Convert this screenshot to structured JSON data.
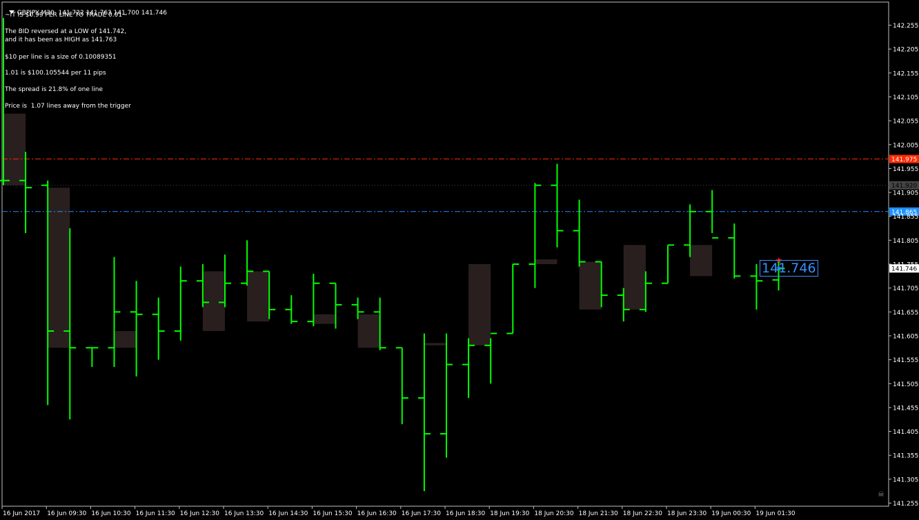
{
  "header": {
    "title": "GBPJPY,M30  141.722 141.763 141.700 141.746",
    "subtitle": "~IT IS $0.99 PER LINE TO TRADE 0.01~"
  },
  "info_lines": [
    "The BID reversed at a LOW of 141.742,",
    "and it has been as HIGH as 141.763",
    "$10 per line is a size of 0.10089351",
    "1.01 is $100.105544 per 11 pips",
    "The spread is 21.8% of one line",
    "Price is  1.07 lines away from the trigger"
  ],
  "current_price_label": "141.746",
  "colors": {
    "background": "#000000",
    "candle": "#00ff00",
    "box": "#2a1f1f",
    "red_line": "#ff2a00",
    "blue_line": "#1e90ff",
    "gray_line": "#555555",
    "axis_text": "#ffffff",
    "star_red": "#ff1a1a",
    "star_blue": "#1e90ff"
  },
  "chart_data": {
    "type": "ohlc",
    "symbol": "GBPJPY",
    "timeframe": "M30",
    "ylim": [
      141.25,
      142.28
    ],
    "y_ticks": [
      "142.255",
      "142.205",
      "142.155",
      "142.105",
      "142.055",
      "142.005",
      "141.955",
      "141.905",
      "141.855",
      "141.805",
      "141.755",
      "141.705",
      "141.655",
      "141.605",
      "141.555",
      "141.505",
      "141.455",
      "141.405",
      "141.355",
      "141.305",
      "141.255"
    ],
    "x_tick_labels": [
      "16 Jun 2017",
      "16 Jun 09:30",
      "16 Jun 10:30",
      "16 Jun 11:30",
      "16 Jun 12:30",
      "16 Jun 13:30",
      "16 Jun 14:30",
      "16 Jun 15:30",
      "16 Jun 16:30",
      "16 Jun 17:30",
      "16 Jun 18:30",
      "18 Jun 19:30",
      "18 Jun 20:30",
      "18 Jun 21:30",
      "18 Jun 22:30",
      "18 Jun 23:30",
      "19 Jun 00:30",
      "19 Jun 01:30"
    ],
    "bars": [
      {
        "o": 141.93,
        "h": 142.27,
        "l": 141.92,
        "c": 141.93
      },
      {
        "o": 141.93,
        "h": 141.99,
        "l": 141.82,
        "c": 141.915
      },
      {
        "o": 141.92,
        "h": 141.93,
        "l": 141.46,
        "c": 141.615
      },
      {
        "o": 141.615,
        "h": 141.83,
        "l": 141.43,
        "c": 141.58
      },
      {
        "o": 141.58,
        "h": 141.58,
        "l": 141.54,
        "c": 141.58
      },
      {
        "o": 141.58,
        "h": 141.77,
        "l": 141.54,
        "c": 141.655
      },
      {
        "o": 141.655,
        "h": 141.72,
        "l": 141.52,
        "c": 141.65
      },
      {
        "o": 141.65,
        "h": 141.685,
        "l": 141.555,
        "c": 141.615
      },
      {
        "o": 141.615,
        "h": 141.75,
        "l": 141.595,
        "c": 141.72
      },
      {
        "o": 141.72,
        "h": 141.755,
        "l": 141.665,
        "c": 141.675
      },
      {
        "o": 141.675,
        "h": 141.775,
        "l": 141.665,
        "c": 141.715
      },
      {
        "o": 141.715,
        "h": 141.805,
        "l": 141.71,
        "c": 141.74
      },
      {
        "o": 141.74,
        "h": 141.74,
        "l": 141.64,
        "c": 141.66
      },
      {
        "o": 141.66,
        "h": 141.69,
        "l": 141.63,
        "c": 141.635
      },
      {
        "o": 141.635,
        "h": 141.735,
        "l": 141.625,
        "c": 141.715
      },
      {
        "o": 141.715,
        "h": 141.715,
        "l": 141.62,
        "c": 141.67
      },
      {
        "o": 141.67,
        "h": 141.685,
        "l": 141.64,
        "c": 141.655
      },
      {
        "o": 141.655,
        "h": 141.685,
        "l": 141.575,
        "c": 141.58
      },
      {
        "o": 141.58,
        "h": 141.58,
        "l": 141.42,
        "c": 141.475
      },
      {
        "o": 141.475,
        "h": 141.61,
        "l": 141.28,
        "c": 141.4
      },
      {
        "o": 141.4,
        "h": 141.61,
        "l": 141.35,
        "c": 141.545
      },
      {
        "o": 141.545,
        "h": 141.6,
        "l": 141.475,
        "c": 141.585
      },
      {
        "o": 141.585,
        "h": 141.6,
        "l": 141.505,
        "c": 141.61
      },
      {
        "o": 141.61,
        "h": 141.755,
        "l": 141.61,
        "c": 141.755
      },
      {
        "o": 141.755,
        "h": 141.925,
        "l": 141.705,
        "c": 141.92
      },
      {
        "o": 141.92,
        "h": 141.965,
        "l": 141.79,
        "c": 141.825
      },
      {
        "o": 141.825,
        "h": 141.89,
        "l": 141.75,
        "c": 141.76
      },
      {
        "o": 141.76,
        "h": 141.76,
        "l": 141.665,
        "c": 141.69
      },
      {
        "o": 141.69,
        "h": 141.705,
        "l": 141.635,
        "c": 141.66
      },
      {
        "o": 141.66,
        "h": 141.74,
        "l": 141.655,
        "c": 141.715
      },
      {
        "o": 141.715,
        "h": 141.795,
        "l": 141.715,
        "c": 141.795
      },
      {
        "o": 141.795,
        "h": 141.88,
        "l": 141.77,
        "c": 141.865
      },
      {
        "o": 141.865,
        "h": 141.91,
        "l": 141.82,
        "c": 141.81
      },
      {
        "o": 141.81,
        "h": 141.84,
        "l": 141.725,
        "c": 141.73
      },
      {
        "o": 141.73,
        "h": 141.755,
        "l": 141.66,
        "c": 141.72
      },
      {
        "o": 141.722,
        "h": 141.763,
        "l": 141.7,
        "c": 141.746
      }
    ],
    "boxes": [
      {
        "from_bar": 0,
        "to_bar": 1,
        "top": 142.07,
        "bottom": 141.92
      },
      {
        "from_bar": 2,
        "to_bar": 3,
        "top": 141.915,
        "bottom": 141.58
      },
      {
        "from_bar": 5,
        "to_bar": 6,
        "top": 141.615,
        "bottom": 141.58
      },
      {
        "from_bar": 9,
        "to_bar": 10,
        "top": 141.74,
        "bottom": 141.615
      },
      {
        "from_bar": 11,
        "to_bar": 12,
        "top": 141.74,
        "bottom": 141.635
      },
      {
        "from_bar": 14,
        "to_bar": 15,
        "top": 141.65,
        "bottom": 141.63
      },
      {
        "from_bar": 16,
        "to_bar": 17,
        "top": 141.65,
        "bottom": 141.58
      },
      {
        "from_bar": 19,
        "to_bar": 20,
        "top": 141.59,
        "bottom": 141.585
      },
      {
        "from_bar": 21,
        "to_bar": 22,
        "top": 141.755,
        "bottom": 141.585
      },
      {
        "from_bar": 24,
        "to_bar": 25,
        "top": 141.765,
        "bottom": 141.755
      },
      {
        "from_bar": 26,
        "to_bar": 27,
        "top": 141.76,
        "bottom": 141.66
      },
      {
        "from_bar": 28,
        "to_bar": 29,
        "top": 141.795,
        "bottom": 141.66
      },
      {
        "from_bar": 31,
        "to_bar": 32,
        "top": 141.795,
        "bottom": 141.73
      }
    ],
    "h_lines": [
      {
        "price": 141.975,
        "color": "#ff2a00",
        "style": "dashdot",
        "label": "141.975"
      },
      {
        "price": 141.92,
        "color": "#444444",
        "style": "dot",
        "label": "141.920"
      },
      {
        "price": 141.865,
        "color": "#1e90ff",
        "style": "dashdot",
        "label": "141.865"
      }
    ],
    "current_price": {
      "price": 141.746,
      "label": "141.746"
    },
    "star_markers": [
      {
        "bar": 35,
        "price": 141.763,
        "color": "red"
      },
      {
        "bar": 35,
        "price": 141.746,
        "color": "blue"
      }
    ]
  }
}
